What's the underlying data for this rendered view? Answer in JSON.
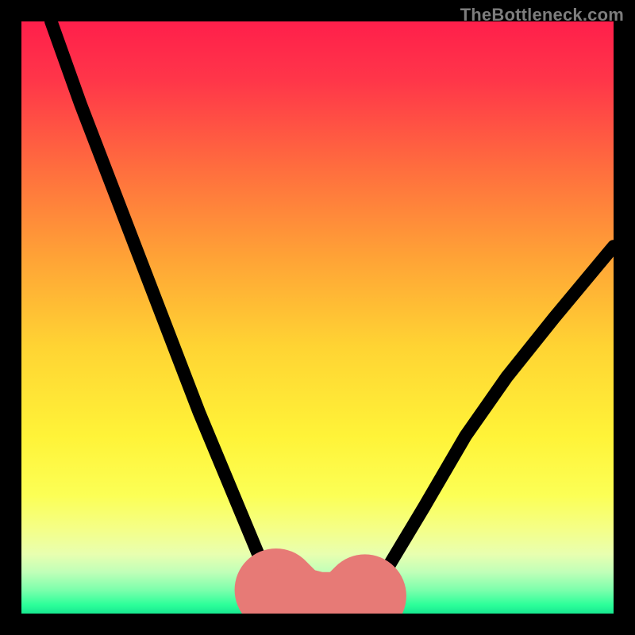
{
  "watermark": {
    "text": "TheBottleneck.com"
  },
  "chart_data": {
    "type": "line",
    "title": "",
    "xlabel": "",
    "ylabel": "",
    "xlim": [
      0,
      100
    ],
    "ylim": [
      0,
      100
    ],
    "grid": false,
    "legend": false,
    "series": [
      {
        "name": "bottleneck-curve",
        "color": "#000000",
        "x": [
          5,
          10,
          15,
          20,
          25,
          30,
          35,
          40,
          43,
          46,
          50,
          54,
          58,
          62,
          68,
          75,
          82,
          90,
          100
        ],
        "y": [
          100,
          86,
          73,
          60,
          47,
          34,
          22,
          10,
          4,
          1,
          0,
          0,
          2,
          8,
          18,
          30,
          40,
          50,
          62
        ]
      }
    ],
    "accent_segments": [
      {
        "name": "left-accent",
        "x": [
          43,
          46
        ],
        "y": [
          4,
          1
        ]
      },
      {
        "name": "floor-accent",
        "x": [
          46,
          50,
          54
        ],
        "y": [
          1,
          0,
          0
        ]
      },
      {
        "name": "right-accent",
        "x": [
          56,
          58
        ],
        "y": [
          1,
          3
        ]
      }
    ],
    "gradient_stops": [
      {
        "offset": 0.0,
        "color": "#ff1f4b"
      },
      {
        "offset": 0.1,
        "color": "#ff3649"
      },
      {
        "offset": 0.25,
        "color": "#ff6e3e"
      },
      {
        "offset": 0.4,
        "color": "#ffa336"
      },
      {
        "offset": 0.55,
        "color": "#ffd433"
      },
      {
        "offset": 0.7,
        "color": "#fff338"
      },
      {
        "offset": 0.8,
        "color": "#fcff55"
      },
      {
        "offset": 0.86,
        "color": "#f4ff8a"
      },
      {
        "offset": 0.9,
        "color": "#e8ffb0"
      },
      {
        "offset": 0.93,
        "color": "#c0ffb8"
      },
      {
        "offset": 0.96,
        "color": "#7dffac"
      },
      {
        "offset": 0.985,
        "color": "#2dff9a"
      },
      {
        "offset": 1.0,
        "color": "#18e890"
      }
    ]
  }
}
